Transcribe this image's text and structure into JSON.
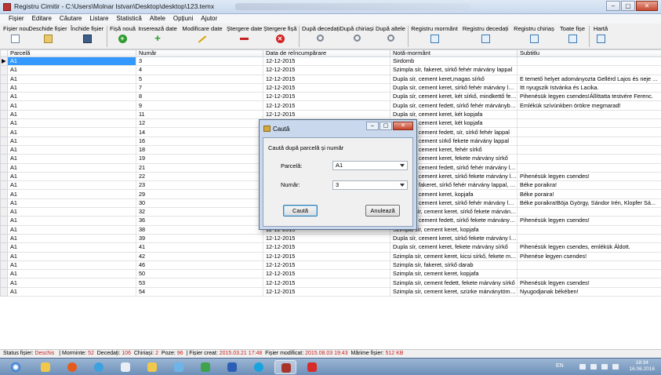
{
  "window": {
    "title": "Registru Cimitir  -  C:\\Users\\Molnar Istvan\\Desktop\\desktop\\123.temx",
    "controls": [
      "–",
      "▢",
      "✕"
    ]
  },
  "menu": [
    "Fișier",
    "Editare",
    "Căutare",
    "Listare",
    "Statistică",
    "Altele",
    "Opțiuni",
    "Ajutor"
  ],
  "toolbar": [
    {
      "label": "Fișier nou",
      "icon": "new-file-icon"
    },
    {
      "label": "Deschide fișier",
      "icon": "open-folder-icon"
    },
    {
      "label": "Închide fișier",
      "icon": "save-icon"
    },
    {
      "label": "Fișă nouă",
      "icon": "add-circle-icon"
    },
    {
      "label": "Inserează date",
      "icon": "plus-icon"
    },
    {
      "label": "Modificare date",
      "icon": "pencil-icon"
    },
    {
      "label": "Ștergere date",
      "icon": "minus-icon"
    },
    {
      "label": "Ștergere fișă",
      "icon": "delete-circle-icon"
    },
    {
      "label": "După decedați",
      "icon": "search-icon"
    },
    {
      "label": "După chiriași",
      "icon": "search-icon"
    },
    {
      "label": "După altele",
      "icon": "search-icon"
    },
    {
      "label": "Registru mormânt",
      "icon": "register-icon"
    },
    {
      "label": "Registru decedați",
      "icon": "register-icon"
    },
    {
      "label": "Registru chiriaș",
      "icon": "register-icon"
    },
    {
      "label": "Toate fișe",
      "icon": "register-icon"
    },
    {
      "label": "Hartă",
      "icon": "map-icon"
    }
  ],
  "grid": {
    "columns": [
      "Parcelă",
      "Număr",
      "Data de reîncumpărare",
      "Notă-mormânt",
      "Subtitlu"
    ],
    "rows": [
      [
        "A1",
        "3",
        "12-12-2015",
        "Sirdomb",
        ""
      ],
      [
        "A1",
        "4",
        "12-12-2015",
        "Szimpla sír, fakeret, sírkő fehér márvány lappal",
        ""
      ],
      [
        "A1",
        "5",
        "12-12-2015",
        "Dupla sír, cement keret,magas sírkő",
        "E temető helyet adományozta Gellérd Lajos és neje ..."
      ],
      [
        "A1",
        "7",
        "12-12-2015",
        "Dupla sír, cement keret, sírkő fehér márvány lappal",
        "Itt nyugszik Istvánka és Lacika."
      ],
      [
        "A1",
        "8",
        "12-12-2015",
        "Dupla sír, cement keret, két sírkő, mindkettő fekete...",
        "Pihenésük legyen csendes!Állíttatta testvére Ferenc."
      ],
      [
        "A1",
        "9",
        "12-12-2015",
        "Dupla sír, cement fedett, sírkő fehér márványból,ké...",
        "Emlékük szívünkben örökre megmarad!"
      ],
      [
        "A1",
        "11",
        "12-12-2015",
        "Dupla sír, cement keret, két kopjafa",
        ""
      ],
      [
        "A1",
        "12",
        "12-12-2015",
        "Dupla sír, cement keret, két kopjafa",
        ""
      ],
      [
        "A1",
        "14",
        "12-12-2015",
        "Dupla sír, cement fedett, sír, sírkő fehér lappal",
        ""
      ],
      [
        "A1",
        "16",
        "12-12-2015",
        "Dupla sír, cement sírkő fekete márvány lappal",
        ""
      ],
      [
        "A1",
        "18",
        "12-12-2015",
        "Dupla sír, cement keret, fehér sírkő",
        ""
      ],
      [
        "A1",
        "19",
        "12-12-2015",
        "Dupla sír, cement keret, fekete márvány sírkő",
        ""
      ],
      [
        "A1",
        "21",
        "12-12-2015",
        "Dupla sír, cement fedett, sírkő fehér márvány lappal",
        ""
      ],
      [
        "A1",
        "22",
        "12-12-2015",
        "Dupla sír, cement keret, sírkő fekete márvány lappal",
        "Pihenésük legyen csendes!"
      ],
      [
        "A1",
        "23",
        "12-12-2015",
        "Dupla sír, fakeret, sírkő fehér márvány lappal, fény...",
        "Béke poraikra!"
      ],
      [
        "A1",
        "29",
        "12-12-2015",
        "Dupla sír, cement keret, kopjafa",
        "Béke poraira!"
      ],
      [
        "A1",
        "30",
        "12-12-2015",
        "Dupla sír, cement keret, sírkő fehér márvány lappal",
        "Béke poraikra!Böja György, Sándor Irén, Klopfer Sá..."
      ],
      [
        "A1",
        "32",
        "12-12-2015",
        "Szimpla sír, cement keret, sírkő fekete márvány lap...",
        ""
      ],
      [
        "A1",
        "36",
        "12-12-2015",
        "Dupla sír, cement fedett, sírkő fekete márvány lappal",
        "Pihenésük legyen csendes!"
      ],
      [
        "A1",
        "38",
        "12-12-2015",
        "Szimpla sír, cement keret, kopjafa",
        ""
      ],
      [
        "A1",
        "39",
        "12-12-2015",
        "Dupla sír, cement keret, sírkő fekete márvány lappal",
        ""
      ],
      [
        "A1",
        "41",
        "12-12-2015",
        "Dupla sír, cement keret, fekete márvány sírkő",
        "Pihenésük legyen csendes, emlékük Áldott."
      ],
      [
        "A1",
        "42",
        "12-12-2015",
        "Szimpla sír, cement keret, kicsi sírkő, fekete márvá...",
        "Pihenése legyen csendes!"
      ],
      [
        "A1",
        "46",
        "12-12-2015",
        "Szimpla sír, fakeret, sírkő darab",
        ""
      ],
      [
        "A1",
        "50",
        "12-12-2015",
        "Szimpla sír, cement keret, kopjafa",
        ""
      ],
      [
        "A1",
        "53",
        "12-12-2015",
        "Szimpla sír, cement fedett, fekete márvány sírkő",
        "Pihenésük legyen csendes!"
      ],
      [
        "A1",
        "54",
        "12-12-2015",
        "Szimpla sír, cement keret, szürke márványtömb lece...",
        "Nyugodjanak békében!"
      ]
    ]
  },
  "dialog": {
    "title": "Caută",
    "caption": "Caută după parcelă și număr",
    "parcel_label": "Parcelă:",
    "parcel_value": "A1",
    "number_label": "Număr:",
    "number_value": "3",
    "search_button": "Caută",
    "cancel_button": "Anulează",
    "controls": [
      "–",
      "▢",
      "✕"
    ]
  },
  "status": {
    "file_status_label": "Status fișier:",
    "file_status_value": "Deschis",
    "graves_label": "| Morminte:",
    "graves_value": "52",
    "deceased_label": "Decedați:",
    "deceased_value": "106",
    "tenants_label": "Chiriași:",
    "tenants_value": "2",
    "photos_label": "Poze:",
    "photos_value": "96",
    "created_label": "| Fișier creat:",
    "created_value": "2015.03.21 17:48",
    "modified_label": "Fișier modificat:",
    "modified_value": "2015.08.03 19:43",
    "size_label": "Mărime fișier:",
    "size_value": "512 KB"
  },
  "taskbar": {
    "lang": "EN",
    "time": "18:34",
    "date": "16.06.2016"
  },
  "colors": {
    "selection": "#3399ff",
    "status_value": "#c81e1e",
    "taskbar": "#6d8fb8"
  }
}
